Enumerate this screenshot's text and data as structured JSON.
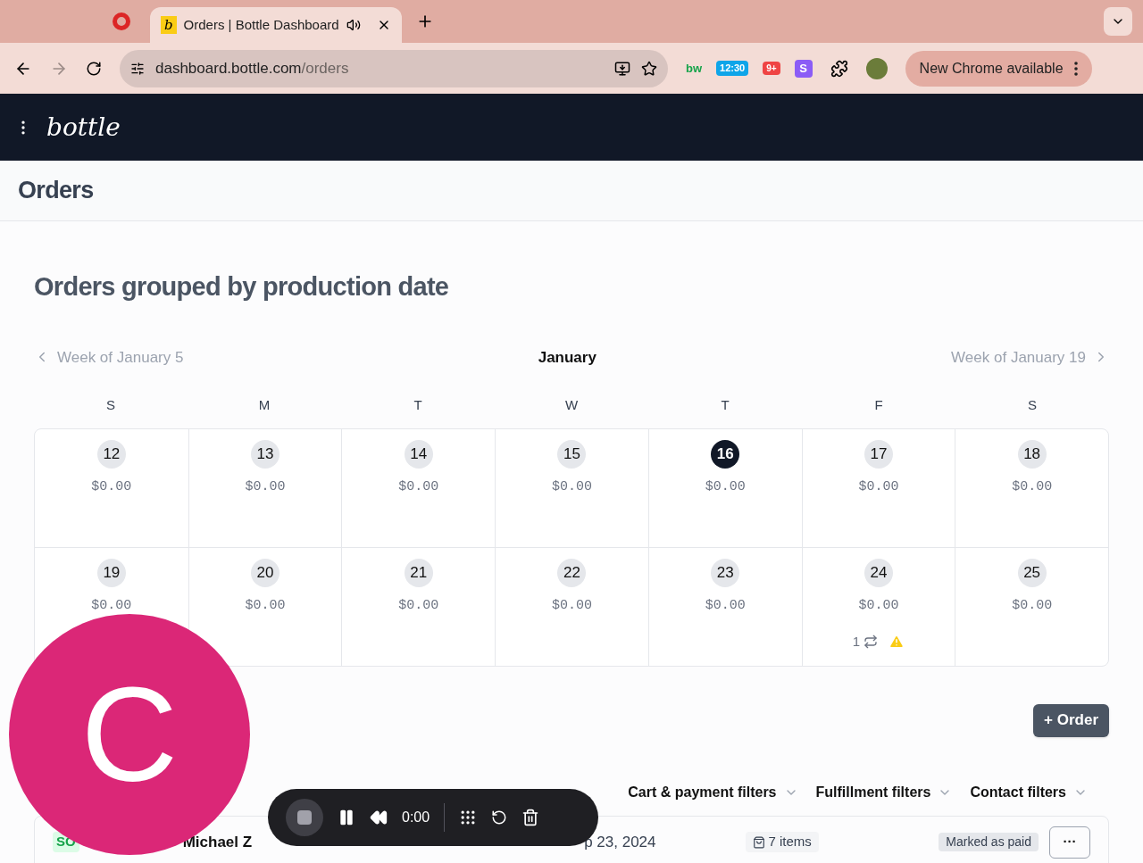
{
  "browser": {
    "tab": {
      "title": "Orders | Bottle Dashboard",
      "favicon": "b",
      "selected": true
    },
    "url_host": "dashboard.bottle.com",
    "url_path": "/orders",
    "extensions": [
      {
        "kind": "bw",
        "text": "bw"
      },
      {
        "kind": "clock",
        "text": "12:30"
      },
      {
        "kind": "badge",
        "text": "9+"
      },
      {
        "kind": "s",
        "text": "S"
      }
    ],
    "update_button": "New Chrome available"
  },
  "app": {
    "logo": "bottle"
  },
  "page": {
    "title": "Orders"
  },
  "calendar": {
    "heading": "Orders grouped by production date",
    "prev": "Week of January 5",
    "month": "January",
    "next": "Week of January 19",
    "weekdays": [
      "S",
      "M",
      "T",
      "W",
      "T",
      "F",
      "S"
    ],
    "days": [
      {
        "day": "12",
        "amount": "$0.00",
        "selected": false
      },
      {
        "day": "13",
        "amount": "$0.00",
        "selected": false
      },
      {
        "day": "14",
        "amount": "$0.00",
        "selected": false
      },
      {
        "day": "15",
        "amount": "$0.00",
        "selected": false
      },
      {
        "day": "16",
        "amount": "$0.00",
        "selected": true
      },
      {
        "day": "17",
        "amount": "$0.00",
        "selected": false
      },
      {
        "day": "18",
        "amount": "$0.00",
        "selected": false
      },
      {
        "day": "19",
        "amount": "$0.00",
        "selected": false
      },
      {
        "day": "20",
        "amount": "$0.00",
        "selected": false
      },
      {
        "day": "21",
        "amount": "$0.00",
        "selected": false
      },
      {
        "day": "22",
        "amount": "$0.00",
        "selected": false
      },
      {
        "day": "23",
        "amount": "$0.00",
        "selected": false
      },
      {
        "day": "24",
        "amount": "$0.00",
        "selected": false,
        "subscriptions": "1",
        "warning": true
      },
      {
        "day": "25",
        "amount": "$0.00",
        "selected": false
      }
    ]
  },
  "order_button": "+ Order",
  "filters": [
    "Cart & payment filters",
    "Fulfillment filters",
    "Contact filters"
  ],
  "orders": [
    {
      "status": "SO",
      "customer": "Michael Z",
      "date": "p 23, 2024",
      "items": "7 items",
      "payment": "Marked as paid",
      "menu": "···"
    }
  ],
  "avatar": {
    "letter": "C"
  },
  "recorder": {
    "time": "0:00"
  }
}
